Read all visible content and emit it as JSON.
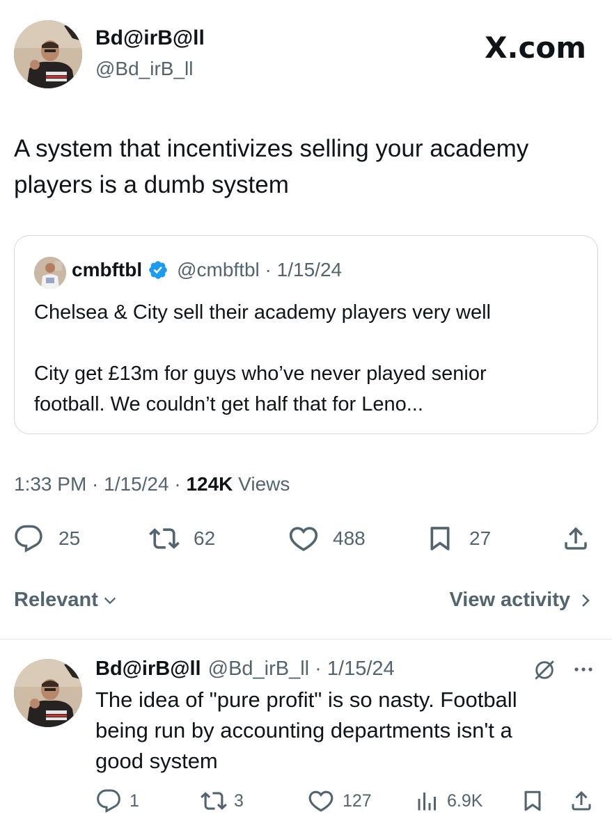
{
  "brand": {
    "label": "X.com"
  },
  "tweet": {
    "display_name": "Bd@irB@ll",
    "handle": "@Bd_irB_ll",
    "text_line1": "A system that incentivizes selling your academy",
    "text_line2": "players is a dumb system",
    "meta_time": "1:33 PM · 1/15/24 · ",
    "meta_views_count": "124K",
    "meta_views_label": " Views",
    "stats": {
      "replies": "25",
      "retweets": "62",
      "likes": "488",
      "bookmarks": "27"
    }
  },
  "quote": {
    "display_name": "cmbftbl",
    "handle_date": "@cmbftbl · 1/15/24",
    "line1": "Chelsea & City sell their academy players very well",
    "line2": "City get £13m for guys who’ve never played senior",
    "line3": "football. We couldn’t get half that for Leno..."
  },
  "replies_bar": {
    "sort_label": "Relevant",
    "activity_label": "View activity"
  },
  "reply": {
    "display_name": "Bd@irB@ll",
    "handle_date": "@Bd_irB_ll · 1/15/24",
    "line1": "The idea of \"pure profit\" is so nasty. Football",
    "line2": "being run by accounting departments isn't a",
    "line3": "good system",
    "stats": {
      "replies": "1",
      "retweets": "3",
      "likes": "127",
      "views": "6.9K"
    }
  },
  "colors": {
    "text": "#0f1419",
    "muted": "#536471",
    "border": "#cfd9de",
    "verified": "#1d9bf0"
  },
  "icons": [
    "reply-icon",
    "retweet-icon",
    "like-icon",
    "bookmark-icon",
    "share-icon",
    "views-icon",
    "grok-icon",
    "more-icon",
    "chevron-down-icon",
    "chevron-right-icon",
    "verified-badge-icon"
  ]
}
